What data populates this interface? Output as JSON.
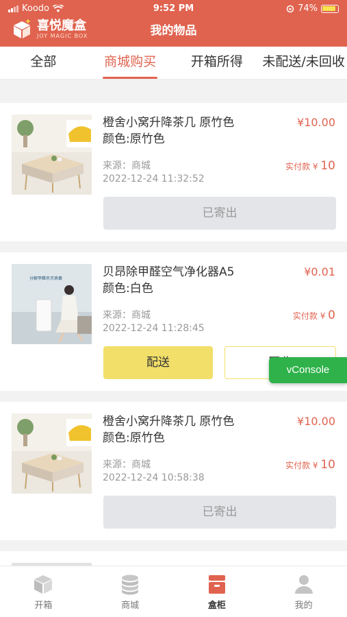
{
  "status_bar": {
    "carrier": "Koodo",
    "time": "9:52 PM",
    "battery": "74%"
  },
  "header": {
    "logo_cn": "喜悦魔盒",
    "logo_en": "JOY MAGIC BOX",
    "title": "我的物品"
  },
  "tabs": [
    {
      "label": "全部",
      "active": false
    },
    {
      "label": "商城购买",
      "active": true
    },
    {
      "label": "开箱所得",
      "active": false
    },
    {
      "label": "未配送/未回收",
      "active": false
    }
  ],
  "items": [
    {
      "title": "橙舍小窝升降茶几 原竹色",
      "color": "颜色:原竹色",
      "price": "¥10.00",
      "source": "来源：商城",
      "date": "2022-12-24 11:32:52",
      "paid_label": "实付款 ¥",
      "paid_value": "10",
      "status_button": "已寄出"
    },
    {
      "title": "贝昂除甲醛空气净化器A5",
      "color": "颜色:白色",
      "price": "¥0.01",
      "source": "来源：商城",
      "date": "2022-12-24 11:28:45",
      "paid_label": "实付款 ¥",
      "paid_value": "0",
      "deliver_button": "配送",
      "recycle_button": "回收",
      "thumb_text": "分解甲醛杀灭病毒"
    },
    {
      "title": "橙舍小窝升降茶几 原竹色",
      "color": "颜色:原竹色",
      "price": "¥10.00",
      "source": "来源：商城",
      "date": "2022-12-24 10:58:38",
      "paid_label": "实付款 ¥",
      "paid_value": "10",
      "status_button": "已寄出"
    }
  ],
  "vconsole": "vConsole",
  "bottom_nav": [
    {
      "label": "开箱",
      "icon": "cube-icon",
      "active": false
    },
    {
      "label": "商城",
      "icon": "coins-icon",
      "active": false
    },
    {
      "label": "盒柜",
      "icon": "cabinet-icon",
      "active": true
    },
    {
      "label": "我的",
      "icon": "user-icon",
      "active": false
    }
  ],
  "colors": {
    "brand": "#e0634f",
    "button_yellow": "#f2df6a",
    "vconsole_green": "#2fb24a"
  }
}
